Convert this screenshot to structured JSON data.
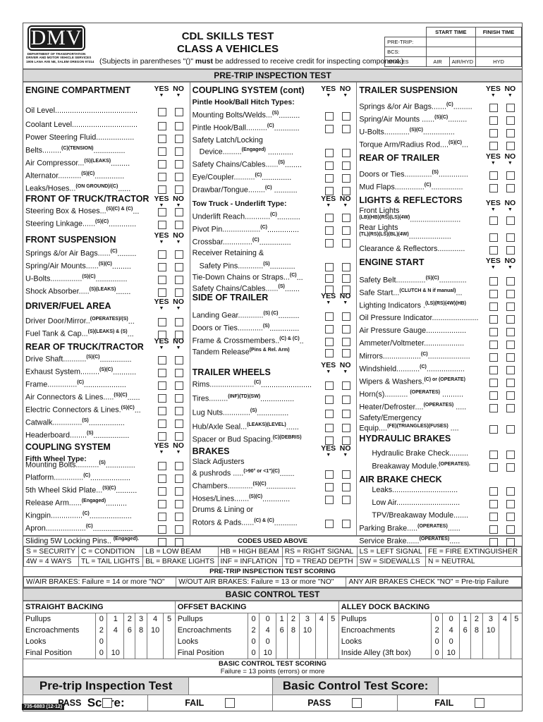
{
  "header": {
    "logo": "DMV",
    "agency_lines": [
      "DEPARTMENT OF TRANSPORTATION",
      "DRIVER AND MOTOR VEHICLE SERVICES",
      "1905 LANA AVE NE, SALEM OREGON 97314"
    ],
    "title_line1": "CDL SKILLS TEST",
    "title_line2": "CLASS A VEHICLES",
    "note_pre": "(Subjects in parentheses \"()\" ",
    "note_bold": "must",
    "note_post": " be addressed to receive credit for inspecting component.)",
    "time_table": {
      "start_time": "START TIME",
      "finish_time": "FINISH TIME",
      "pre_trip": "PRE-TRIP:",
      "bcs": "BCS:",
      "brakes": "BRAKES",
      "brake_types": [
        "AIR",
        "AIR/HYD",
        "HYD"
      ]
    }
  },
  "pretrip_band": "PRE-TRIP INSPECTION TEST",
  "yes": "YES",
  "no": "NO",
  "col1": {
    "engine": {
      "title": "ENGINE COMPARTMENT",
      "items": [
        {
          "label": "Oil Level.......................................",
          "code": ""
        },
        {
          "label": "Coolant Level...............................",
          "code": ""
        },
        {
          "label": "Power Steering Fluid..................",
          "code": ""
        },
        {
          "label": "Belts.........",
          "code": "(C)(TENSION)",
          "tail": "..............."
        },
        {
          "label": "Air Compressor...",
          "code": "(S)(LEAKS)",
          "tail": "........."
        },
        {
          "label": "Alternator...........",
          "code": "(S)(C)",
          "tail": ".............."
        },
        {
          "label": "Leaks/Hoses...",
          "code": "(ON GROUND)/(C)",
          "tail": "......"
        }
      ]
    },
    "front_truck": {
      "title": "FRONT OF TRUCK/TRACTOR",
      "items": [
        {
          "label": "Steering Box & Hoses...",
          "code": "(S)(C) & (C)",
          "tail": "..."
        },
        {
          "label": "Steering Linkage......",
          "code": "(S)(C)",
          "tail": "............."
        }
      ]
    },
    "front_susp": {
      "title": "FRONT SUSPENSION",
      "items": [
        {
          "label": "Springs &/or Air Bags......",
          "code": "(C)",
          "tail": "........."
        },
        {
          "label": "Spring/Air Mounts......",
          "code": "(S)(C)",
          "tail": "........."
        },
        {
          "label": "U-Bolts...............",
          "code": "(S)(C)",
          "tail": "..............."
        },
        {
          "label": "Shock Absorber.....",
          "code": "(S)(LEAKS)",
          "tail": "......."
        }
      ]
    },
    "driver_fuel": {
      "title": "DRIVER/FUEL AREA",
      "items": [
        {
          "label": "Driver Door/Mirror..",
          "code": "(OPERATES)/(S)",
          "tail": "..."
        },
        {
          "label": "Fuel Tank & Cap...",
          "code": "(S)(LEAKS) & (S)",
          "tail": "..."
        }
      ]
    },
    "rear_truck": {
      "title": "REAR OF TRUCK/TRACTOR",
      "items": [
        {
          "label": "Drive Shaft...........",
          "code": "(S)(C)",
          "tail": "..............."
        },
        {
          "label": "Exhaust System.........",
          "code": "(S)(C)",
          "tail": "..........."
        },
        {
          "label": "Frame..............",
          "code": "(C)",
          "tail": "...................."
        },
        {
          "label": "Air Connectors & Lines.....",
          "code": "(S)(C)",
          "tail": "......"
        },
        {
          "label": "Electric Connectors & Lines.",
          "code": "(S)(C)",
          "tail": "..."
        },
        {
          "label": "Catwalk..............",
          "code": "(S)",
          "tail": "................."
        },
        {
          "label": "Headerboard........",
          "code": "(S)",
          "tail": "................."
        }
      ]
    },
    "coupling": {
      "title": "COUPLING SYSTEM",
      "subtitle": "Fifth Wheel Type:",
      "items": [
        {
          "label": "Mounting Bolts...........",
          "code": "(S)",
          "tail": ".............."
        },
        {
          "label": "Platform..............",
          "code": "(C)",
          "tail": "..................."
        },
        {
          "label": "5th Wheel Skid Plate...",
          "code": "(S)(C)",
          "tail": ".........."
        },
        {
          "label": "Release Arm......",
          "code": "(Engaged)",
          "tail": ".........."
        },
        {
          "label": "Kingpin...............",
          "code": "(C)",
          "tail": "...................."
        },
        {
          "label": "Apron...................",
          "code": "(C)",
          "tail": "..................."
        },
        {
          "label": "Sliding 5W Locking Pins.. ",
          "code": "(Engaged).",
          "tail": ""
        }
      ]
    }
  },
  "col2": {
    "coupling_cont": {
      "title": "COUPLING SYSTEM (cont)",
      "subtitle": "Pintle Hook/Ball Hitch Types:",
      "items": [
        {
          "label": "Mounting Bolts/Welds...",
          "code": "(S)",
          "tail": ".........."
        },
        {
          "label": "Pintle Hook/Ball..........",
          "code": "(C)",
          "tail": "............"
        },
        {
          "label": "Safety Latch/Locking",
          "code": "",
          "tail": "",
          "nobox": true
        },
        {
          "label": "Device.........",
          "code": "(Engaged)",
          "tail": " ............",
          "indent": true
        },
        {
          "label": "Safety Chains/Cables......",
          "code": "(S)",
          "tail": "........"
        },
        {
          "label": "Eye/Coupler..........",
          "code": "(C)",
          "tail": ".............."
        },
        {
          "label": "Drawbar/Tongue........",
          "code": "(C)",
          "tail": " ..........."
        }
      ]
    },
    "tow_truck": {
      "subtitle": "Tow Truck - Underlift Type:",
      "items": [
        {
          "label": "Underlift Reach............",
          "code": "(C)",
          "tail": "..........."
        },
        {
          "label": "Pivot Pin..................",
          "code": "(C)",
          "tail": "..............."
        },
        {
          "label": "Crossbar..............",
          "code": "(C)",
          "tail": "..............."
        },
        {
          "label": "Receiver Retaining &",
          "code": "",
          "tail": "",
          "nobox": true
        },
        {
          "label": "Safety Pins............",
          "code": "(S)",
          "tail": "............",
          "indent": true
        },
        {
          "label": "Tie-Down Chains or Straps...",
          "code": "(C)",
          "tail": "..."
        },
        {
          "label": "Safety Chains/Cables......",
          "code": "(S)",
          "tail": "......."
        }
      ]
    },
    "side_trailer": {
      "title": "SIDE OF TRAILER",
      "items": [
        {
          "label": "Landing Gear............",
          "code": "(S) (C)",
          "tail": ".........."
        },
        {
          "label": "Doors or Ties............",
          "code": "(S)",
          "tail": ".............."
        },
        {
          "label": "Frame & Crossmembers..",
          "code": "(C) & (C)",
          "tail": ".."
        },
        {
          "label": "Tandem Release",
          "code": "(Pins & Rel. Arm)",
          "tail": ""
        }
      ]
    },
    "trailer_wheels": {
      "title": "TRAILER WHEELS",
      "items": [
        {
          "label": "Rims.....................",
          "code": "(C)",
          "tail": "........................"
        },
        {
          "label": "Tires.........",
          "code": "(INF)(TD)(SW)",
          "tail": "................"
        },
        {
          "label": "Lug Nuts.............",
          "code": "(S)",
          "tail": "..............."
        },
        {
          "label": "Hub/Axle Seal...",
          "code": "(LEAKS)(LEVEL)",
          "tail": "......"
        },
        {
          "label": "Spacer or Bud Spacing.",
          "code": "(C)(DEBRIS)",
          "tail": ""
        }
      ]
    },
    "brakes": {
      "title": "BRAKES",
      "items": [
        {
          "label": "Slack Adjusters",
          "code": "",
          "tail": "",
          "nobox": true
        },
        {
          "label": "& pushrods .....",
          "code": "(>90° or <1\")(C)",
          "tail": "......."
        },
        {
          "label": "Chambers............",
          "code": "(S)(C)",
          "tail": ".............."
        },
        {
          "label": "Hoses/Lines.......",
          "code": "(S)(C)",
          "tail": "............."
        },
        {
          "label": "Drums & Lining or",
          "code": "",
          "tail": "",
          "nobox": true
        },
        {
          "label": "Rotors & Pads......",
          "code": "(C) & (C)",
          "tail": "..........."
        }
      ]
    }
  },
  "col3": {
    "trailer_susp": {
      "title": "TRAILER SUSPENSION",
      "items": [
        {
          "label": "Springs &/or Air Bags.......",
          "code": "(C)",
          "tail": "........."
        },
        {
          "label": "Spring/Air Mounts ......",
          "code": "(S)(C)",
          "tail": "........."
        },
        {
          "label": "U-Bolts............",
          "code": "(S)(C)",
          "tail": "..............."
        },
        {
          "label": "Torque Arm/Radius Rod....",
          "code": "(S)(C)",
          "tail": "..."
        }
      ]
    },
    "rear_trailer": {
      "title": "REAR OF TRAILER",
      "items": [
        {
          "label": "Doors or Ties.............",
          "code": "(S)",
          "tail": ".............."
        },
        {
          "label": "Mud Flaps..............",
          "code": "(C)",
          "tail": "..............."
        }
      ]
    },
    "lights": {
      "title": "LIGHTS & REFLECTORS",
      "items": [
        {
          "label": "Front Lights",
          "code": "",
          "tail": "",
          "nobox": true
        },
        {
          "label": "",
          "code": "(LB)(HB)(RS)(LS)(4W)",
          "tail": "........................"
        },
        {
          "label": "Rear Lights",
          "code": "",
          "tail": "",
          "nobox": true
        },
        {
          "label": "",
          "code": "(TL)(RS)(LS)(BL)(4W)",
          "tail": "...................."
        },
        {
          "label": "Clearance & Reflectors.............",
          "code": "",
          "tail": ""
        }
      ]
    },
    "engine_start": {
      "title": "ENGINE START",
      "items": [
        {
          "label": "Safety Belt..............",
          "code": "(S)(C)",
          "tail": "............."
        },
        {
          "label": "Safe Start...",
          "code": "(CLUTCH & N if manual)",
          "tail": "..."
        },
        {
          "label": "Lighting Indicators .",
          "code": "(LS)(RS)(4W)(HB)",
          "tail": ""
        },
        {
          "label": "Oil Pressure Indicator......................",
          "code": "",
          "tail": ""
        },
        {
          "label": "Air Pressure Gauge...................",
          "code": "",
          "tail": ""
        },
        {
          "label": "Ammeter/Voltmeter...................",
          "code": "",
          "tail": ""
        },
        {
          "label": "Mirrors..................",
          "code": "(C)",
          "tail": "...................."
        },
        {
          "label": "Windshield...........",
          "code": "(C)",
          "tail": ".................."
        },
        {
          "label": "Wipers & Washers.",
          "code": "(C) or (OPERATE)",
          "tail": ""
        },
        {
          "label": "Horn(s)........... ",
          "code": "(OPERATES)",
          "tail": " .........."
        },
        {
          "label": "Heater/Defroster....",
          "code": "(OPERATES)",
          "tail": " ....."
        },
        {
          "label": "Safety/Emergency",
          "code": "",
          "tail": "",
          "nobox": true
        },
        {
          "label": "Equip....",
          "code": "(FE)(TRIANGLES)(FUSES)",
          "tail": " ...."
        }
      ]
    },
    "hydraulic": {
      "title": "HYDRAULIC BRAKES",
      "items": [
        {
          "label": "Hydraulic Brake Check.........",
          "code": "",
          "tail": "",
          "indent": true
        },
        {
          "label": "Breakaway Module.",
          "code": "(OPERATES).",
          "tail": "",
          "indent": true
        }
      ]
    },
    "air_brake": {
      "title": "AIR BRAKE CHECK",
      "items": [
        {
          "label": "Leaks...............................",
          "code": "",
          "tail": "",
          "indent": true
        },
        {
          "label": "Low Air..............................",
          "code": "",
          "tail": "",
          "indent": true
        },
        {
          "label": "TPV/Breakaway Module.......",
          "code": "",
          "tail": "",
          "indent": true
        },
        {
          "label": "Parking Brake.....",
          "code": "(OPERATES)",
          "tail": "......"
        },
        {
          "label": "Service Brake......",
          "code": "(OPERATES)",
          "tail": "....."
        }
      ]
    }
  },
  "codes": {
    "title": "CODES USED ABOVE",
    "row1": [
      "S = SECURITY",
      "C = CONDITION",
      "LB = LOW BEAM",
      "HB = HIGH BEAM",
      "RS = RIGHT SIGNAL",
      "LS = LEFT SIGNAL",
      "FE = FIRE EXTINGUISHER"
    ],
    "row2": [
      "4W = 4 WAYS",
      "TL = TAIL LIGHTS",
      "BL = BRAKE LIGHTS",
      "INF = INFLATION",
      "TD = TREAD DEPTH",
      "SW = SIDEWALLS",
      "N = NEUTRAL"
    ]
  },
  "pretrip_scoring": {
    "title": "PRE-TRIP INSPECTION TEST SCORING",
    "items": [
      "W/AIR BRAKES: Failure = 14 or more \"NO\"",
      "W/OUT AIR BRAKES: Failure = 13 or more \"NO\"",
      "ANY AIR BRAKES CHECK \"NO\" = Pre-trip Failure"
    ]
  },
  "bct_band": "BASIC CONTROL TEST",
  "bct": {
    "straight": {
      "title": "STRAIGHT BACKING",
      "rows": [
        {
          "label": "Pullups",
          "vals": [
            "0",
            "1",
            "2",
            "3",
            "4",
            "5"
          ]
        },
        {
          "label": "Encroachments",
          "vals": [
            "2",
            "4",
            "6",
            "8",
            "10",
            ""
          ]
        },
        {
          "label": "Looks",
          "vals": [
            "0",
            "",
            "",
            "",
            "",
            ""
          ]
        },
        {
          "label": "Final Position",
          "vals": [
            "0",
            "10",
            "",
            "",
            "",
            ""
          ]
        }
      ]
    },
    "offset": {
      "title": "OFFSET BACKING",
      "rows": [
        {
          "label": "Pullups",
          "vals": [
            "0",
            "0",
            "1",
            "2",
            "3",
            "4",
            "5"
          ]
        },
        {
          "label": "Encroachments",
          "vals": [
            "2",
            "4",
            "6",
            "8",
            "10",
            "",
            ""
          ]
        },
        {
          "label": "Looks",
          "vals": [
            "0",
            "0",
            "",
            "",
            "",
            "",
            ""
          ]
        },
        {
          "label": "Final Position",
          "vals": [
            "0",
            "10",
            "",
            "",
            "",
            "",
            ""
          ]
        }
      ]
    },
    "alley": {
      "title": "ALLEY DOCK BACKING",
      "rows": [
        {
          "label": "Pullups",
          "vals": [
            "0",
            "0",
            "1",
            "2",
            "3",
            "4",
            "5"
          ]
        },
        {
          "label": "Encroachments",
          "vals": [
            "2",
            "4",
            "6",
            "8",
            "10",
            "",
            ""
          ]
        },
        {
          "label": "Looks",
          "vals": [
            "0",
            "0",
            "",
            "",
            "",
            "",
            ""
          ]
        },
        {
          "label": "Inside Alley (3ft box)",
          "vals": [
            "0",
            "10",
            "",
            "",
            "",
            "",
            ""
          ]
        }
      ]
    },
    "scoring_title": "BASIC CONTROL TEST SCORING",
    "scoring_text": "Failure = 13 points (errors) or more"
  },
  "scores": {
    "pretrip_label": "Pre-trip Inspection Test Score:",
    "bct_label": "Basic Control Test Score:",
    "pass": "PASS",
    "fail": "FAIL"
  },
  "form_number": "735-6883 (12-12)"
}
